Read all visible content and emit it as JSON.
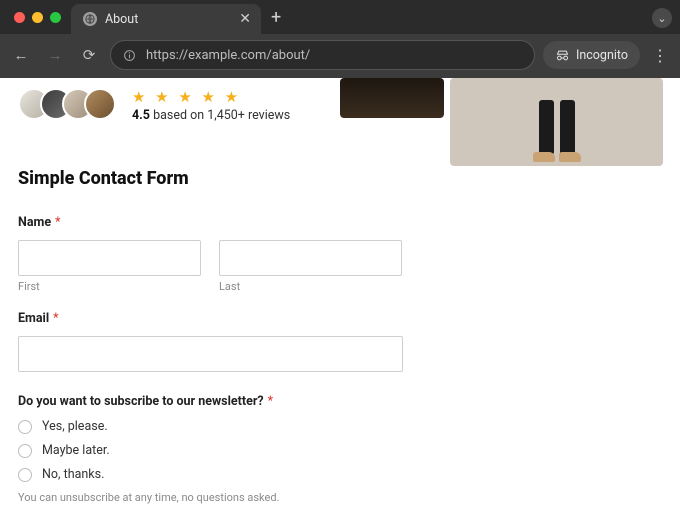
{
  "browser": {
    "tab_title": "About",
    "url": "https://example.com/about/",
    "incognito_label": "Incognito"
  },
  "reviews": {
    "stars": "★ ★ ★ ★ ★",
    "score": "4.5",
    "suffix": " based on 1,450+ reviews"
  },
  "form": {
    "heading": "Simple Contact Form",
    "name": {
      "label": "Name",
      "first_sub": "First",
      "last_sub": "Last"
    },
    "email": {
      "label": "Email"
    },
    "newsletter": {
      "question": "Do you want to subscribe to our newsletter?",
      "options": [
        "Yes, please.",
        "Maybe later.",
        "No, thanks."
      ],
      "hint": "You can unsubscribe at any time, no questions asked."
    },
    "required_marker": "*"
  }
}
